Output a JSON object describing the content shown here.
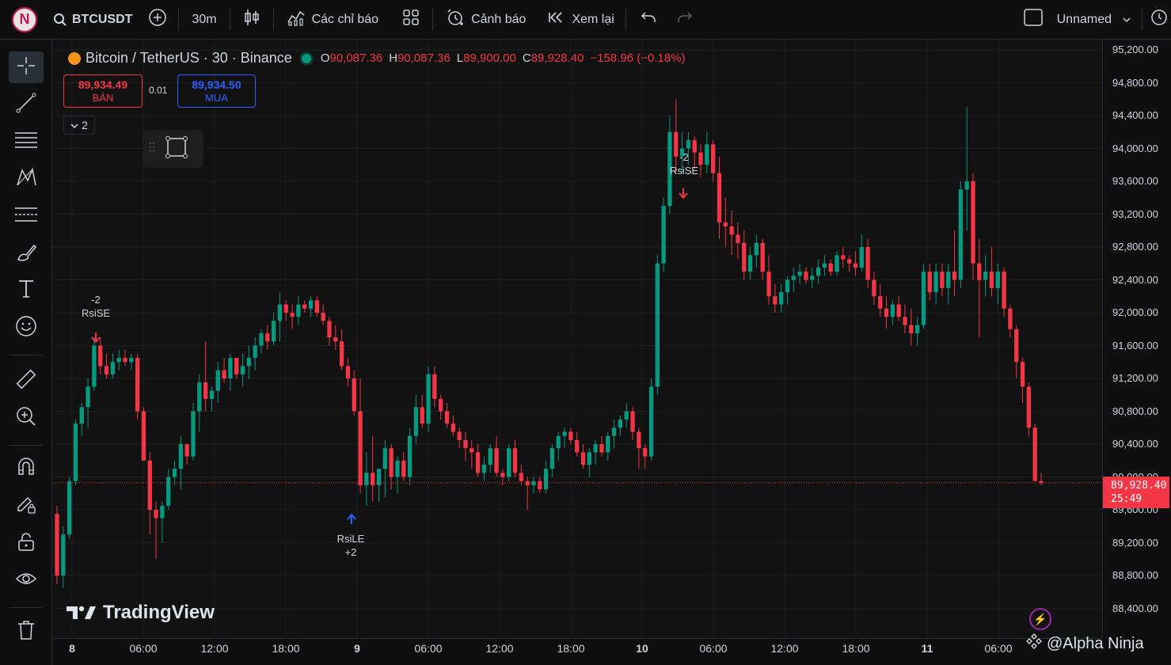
{
  "topbar": {
    "avatar_letter": "N",
    "symbol": "BTCUSDT",
    "interval": "30m",
    "indicators_label": "Các chỉ báo",
    "alerts_label": "Cảnh báo",
    "replay_label": "Xem lại",
    "layout_name": "Unnamed"
  },
  "legend": {
    "title": "Bitcoin / TetherUS · 30 · Binance",
    "o_label": "O",
    "o_value": "90,087.36",
    "h_label": "H",
    "h_value": "90,087.36",
    "l_label": "L",
    "l_value": "89,900.00",
    "c_label": "C",
    "c_value": "89,928.40",
    "change": "−158.96 (−0.18%)"
  },
  "trade": {
    "sell_price": "89,934.49",
    "sell_label": "BÁN",
    "spread": "0.01",
    "buy_price": "89,934.50",
    "buy_label": "MUA",
    "collapse_count": "2"
  },
  "signals": [
    {
      "top": "-2",
      "bottom": "RsiSE"
    },
    {
      "top": "-2",
      "bottom": "RsiSE"
    },
    {
      "top": "RsiLE",
      "bottom": "+2"
    }
  ],
  "price_axis": {
    "ticks": [
      "95,200.00",
      "94,800.00",
      "94,400.00",
      "94,000.00",
      "93,600.00",
      "93,200.00",
      "92,800.00",
      "92,400.00",
      "92,000.00",
      "91,600.00",
      "91,200.00",
      "90,800.00",
      "90,400.00",
      "90,000.00",
      "89,600.00",
      "89,200.00",
      "88,800.00",
      "88,400.00"
    ],
    "last_price": "89,928.40",
    "countdown": "25:49"
  },
  "time_axis": {
    "ticks": [
      "8",
      "06:00",
      "12:00",
      "18:00",
      "9",
      "06:00",
      "12:00",
      "18:00",
      "10",
      "06:00",
      "12:00",
      "18:00",
      "11",
      "06:00"
    ]
  },
  "branding": {
    "logo_text": "TradingView",
    "watermark": "@Alpha Ninja"
  },
  "colors": {
    "up": "#089981",
    "down": "#f23645",
    "buy": "#2962ff",
    "bg": "#121212"
  },
  "chart_data": {
    "type": "candlestick",
    "symbol": "BTCUSDT",
    "interval": "30",
    "ylim": [
      88200,
      95400
    ],
    "x_start_label": "8",
    "candles_ohlc": [
      [
        89550,
        89650,
        88700,
        88800
      ],
      [
        88800,
        89400,
        88650,
        89300
      ],
      [
        89300,
        90000,
        89250,
        89950
      ],
      [
        89950,
        90700,
        89900,
        90650
      ],
      [
        90650,
        90900,
        90500,
        90850
      ],
      [
        90850,
        91200,
        90600,
        91100
      ],
      [
        91100,
        91700,
        91050,
        91600
      ],
      [
        91600,
        91700,
        91250,
        91350
      ],
      [
        91350,
        91500,
        91200,
        91250
      ],
      [
        91250,
        91500,
        91200,
        91400
      ],
      [
        91400,
        91550,
        91300,
        91450
      ],
      [
        91450,
        91550,
        91350,
        91400
      ],
      [
        91400,
        91500,
        91300,
        91450
      ],
      [
        91450,
        91500,
        90700,
        90800
      ],
      [
        90800,
        90850,
        90200,
        90200
      ],
      [
        90200,
        90300,
        89300,
        89600
      ],
      [
        89600,
        89700,
        89000,
        89500
      ],
      [
        89500,
        89700,
        89200,
        89650
      ],
      [
        89650,
        90100,
        89600,
        90000
      ],
      [
        90000,
        90200,
        89900,
        90100
      ],
      [
        90100,
        90500,
        89850,
        90400
      ],
      [
        90400,
        90400,
        90150,
        90250
      ],
      [
        90250,
        90900,
        90200,
        90800
      ],
      [
        90800,
        91250,
        90550,
        91150
      ],
      [
        91150,
        91650,
        90800,
        90950
      ],
      [
        90950,
        91100,
        90800,
        91050
      ],
      [
        91050,
        91400,
        90900,
        91300
      ],
      [
        91300,
        91450,
        91150,
        91200
      ],
      [
        91200,
        91500,
        91050,
        91450
      ],
      [
        91450,
        91450,
        91200,
        91250
      ],
      [
        91250,
        91500,
        91100,
        91350
      ],
      [
        91350,
        91600,
        91200,
        91450
      ],
      [
        91450,
        91700,
        91300,
        91600
      ],
      [
        91600,
        91800,
        91500,
        91750
      ],
      [
        91750,
        91850,
        91550,
        91650
      ],
      [
        91650,
        92000,
        91600,
        91900
      ],
      [
        91900,
        92250,
        91650,
        92100
      ],
      [
        92100,
        92150,
        91900,
        92000
      ],
      [
        92000,
        92100,
        91800,
        91950
      ],
      [
        91950,
        92200,
        91850,
        92100
      ],
      [
        92100,
        92150,
        92000,
        92050
      ],
      [
        92050,
        92200,
        91950,
        92150
      ],
      [
        92150,
        92200,
        91950,
        92000
      ],
      [
        92000,
        92100,
        91850,
        91900
      ],
      [
        91900,
        91950,
        91600,
        91700
      ],
      [
        91700,
        91850,
        91550,
        91650
      ],
      [
        91650,
        91800,
        91300,
        91350
      ],
      [
        91350,
        91450,
        91100,
        91200
      ],
      [
        91200,
        91300,
        90750,
        90800
      ],
      [
        90800,
        91200,
        89800,
        89900
      ],
      [
        89900,
        90300,
        89650,
        90050
      ],
      [
        90050,
        90500,
        89700,
        89900
      ],
      [
        89900,
        90000,
        89700,
        90100
      ],
      [
        90100,
        90450,
        89750,
        90350
      ],
      [
        90350,
        90400,
        89850,
        90000
      ],
      [
        90000,
        90250,
        89800,
        90200
      ],
      [
        90200,
        90300,
        89950,
        90000
      ],
      [
        90000,
        90600,
        89900,
        90500
      ],
      [
        90500,
        91000,
        90400,
        90850
      ],
      [
        90850,
        91000,
        90600,
        90650
      ],
      [
        90650,
        91350,
        90550,
        91250
      ],
      [
        91250,
        91350,
        90850,
        90950
      ],
      [
        90950,
        91000,
        90700,
        90800
      ],
      [
        90800,
        90900,
        90600,
        90650
      ],
      [
        90650,
        90750,
        90500,
        90550
      ],
      [
        90550,
        90600,
        90350,
        90450
      ],
      [
        90450,
        90550,
        90200,
        90350
      ],
      [
        90350,
        90450,
        90100,
        90300
      ],
      [
        90300,
        90400,
        90000,
        90050
      ],
      [
        90050,
        90250,
        89950,
        90150
      ],
      [
        90150,
        90400,
        90050,
        90350
      ],
      [
        90350,
        90500,
        90000,
        90050
      ],
      [
        90050,
        90100,
        89900,
        90000
      ],
      [
        90000,
        90400,
        89950,
        90350
      ],
      [
        90350,
        90450,
        90000,
        90050
      ],
      [
        90050,
        90150,
        89900,
        89950
      ],
      [
        89950,
        90000,
        89600,
        89900
      ],
      [
        89900,
        90000,
        89800,
        89950
      ],
      [
        89950,
        90000,
        89800,
        89850
      ],
      [
        89850,
        90200,
        89800,
        90100
      ],
      [
        90100,
        90400,
        90000,
        90350
      ],
      [
        90350,
        90550,
        90200,
        90500
      ],
      [
        90500,
        90600,
        90350,
        90550
      ],
      [
        90550,
        90600,
        90400,
        90450
      ],
      [
        90450,
        90550,
        90250,
        90300
      ],
      [
        90300,
        90400,
        90100,
        90150
      ],
      [
        90150,
        90350,
        90000,
        90300
      ],
      [
        90300,
        90450,
        90150,
        90400
      ],
      [
        90400,
        90500,
        90250,
        90300
      ],
      [
        90300,
        90550,
        90200,
        90500
      ],
      [
        90500,
        90700,
        90350,
        90600
      ],
      [
        90600,
        90750,
        90500,
        90700
      ],
      [
        90700,
        90900,
        90600,
        90800
      ],
      [
        90800,
        90850,
        90450,
        90550
      ],
      [
        90550,
        90600,
        90100,
        90350
      ],
      [
        90350,
        90400,
        90100,
        90250
      ],
      [
        90250,
        91200,
        90200,
        91100
      ],
      [
        91100,
        92700,
        91000,
        92600
      ],
      [
        92600,
        93400,
        92500,
        93300
      ],
      [
        93300,
        94400,
        93200,
        94200
      ],
      [
        94200,
        94600,
        93700,
        93900
      ],
      [
        93900,
        94200,
        93700,
        94000
      ],
      [
        94000,
        94200,
        93800,
        94100
      ],
      [
        94100,
        94150,
        93750,
        93950
      ],
      [
        93950,
        94050,
        93650,
        93800
      ],
      [
        93800,
        94200,
        93700,
        94050
      ],
      [
        94050,
        94100,
        93600,
        93700
      ],
      [
        93700,
        93900,
        92900,
        93100
      ],
      [
        93100,
        93400,
        92800,
        93050
      ],
      [
        93050,
        93250,
        92700,
        92950
      ],
      [
        92950,
        93100,
        92650,
        92850
      ],
      [
        92850,
        93000,
        92400,
        92500
      ],
      [
        92500,
        92800,
        92400,
        92700
      ],
      [
        92700,
        92950,
        92550,
        92850
      ],
      [
        92850,
        92900,
        92400,
        92500
      ],
      [
        92500,
        92700,
        92100,
        92200
      ],
      [
        92200,
        92350,
        92000,
        92100
      ],
      [
        92100,
        92350,
        92000,
        92250
      ],
      [
        92250,
        92450,
        92100,
        92400
      ],
      [
        92400,
        92550,
        92250,
        92450
      ],
      [
        92450,
        92600,
        92350,
        92500
      ],
      [
        92500,
        92550,
        92350,
        92400
      ],
      [
        92400,
        92550,
        92300,
        92450
      ],
      [
        92450,
        92650,
        92350,
        92550
      ],
      [
        92550,
        92700,
        92450,
        92600
      ],
      [
        92600,
        92650,
        92450,
        92500
      ],
      [
        92500,
        92750,
        92450,
        92700
      ],
      [
        92700,
        92800,
        92550,
        92650
      ],
      [
        92650,
        92700,
        92500,
        92600
      ],
      [
        92600,
        92750,
        92450,
        92550
      ],
      [
        92550,
        92950,
        92500,
        92800
      ],
      [
        92800,
        92900,
        92300,
        92400
      ],
      [
        92400,
        92500,
        92100,
        92200
      ],
      [
        92200,
        92350,
        91950,
        92050
      ],
      [
        92050,
        92200,
        91800,
        91950
      ],
      [
        91950,
        92150,
        91850,
        92100
      ],
      [
        92100,
        92200,
        91900,
        91950
      ],
      [
        91950,
        92100,
        91750,
        91850
      ],
      [
        91850,
        92050,
        91600,
        91750
      ],
      [
        91750,
        91950,
        91600,
        91850
      ],
      [
        91850,
        92600,
        91800,
        92500
      ],
      [
        92500,
        92600,
        92150,
        92250
      ],
      [
        92250,
        92600,
        92100,
        92500
      ],
      [
        92500,
        92600,
        92200,
        92300
      ],
      [
        92300,
        92600,
        92100,
        92500
      ],
      [
        92500,
        93000,
        92200,
        92400
      ],
      [
        92400,
        93600,
        92300,
        93500
      ],
      [
        93500,
        94500,
        93000,
        93600
      ],
      [
        93600,
        93700,
        92400,
        92600
      ],
      [
        92600,
        92900,
        91700,
        92400
      ],
      [
        92400,
        92700,
        92200,
        92500
      ],
      [
        92500,
        92800,
        92200,
        92300
      ],
      [
        92300,
        92600,
        92100,
        92500
      ],
      [
        92500,
        92550,
        91950,
        92050
      ],
      [
        92050,
        92100,
        91700,
        91800
      ],
      [
        91800,
        91850,
        91200,
        91400
      ],
      [
        91400,
        91450,
        90900,
        91100
      ],
      [
        91100,
        91150,
        90500,
        90600
      ],
      [
        90600,
        90650,
        89950,
        89950
      ],
      [
        89950,
        90050,
        89900,
        89928
      ]
    ]
  }
}
